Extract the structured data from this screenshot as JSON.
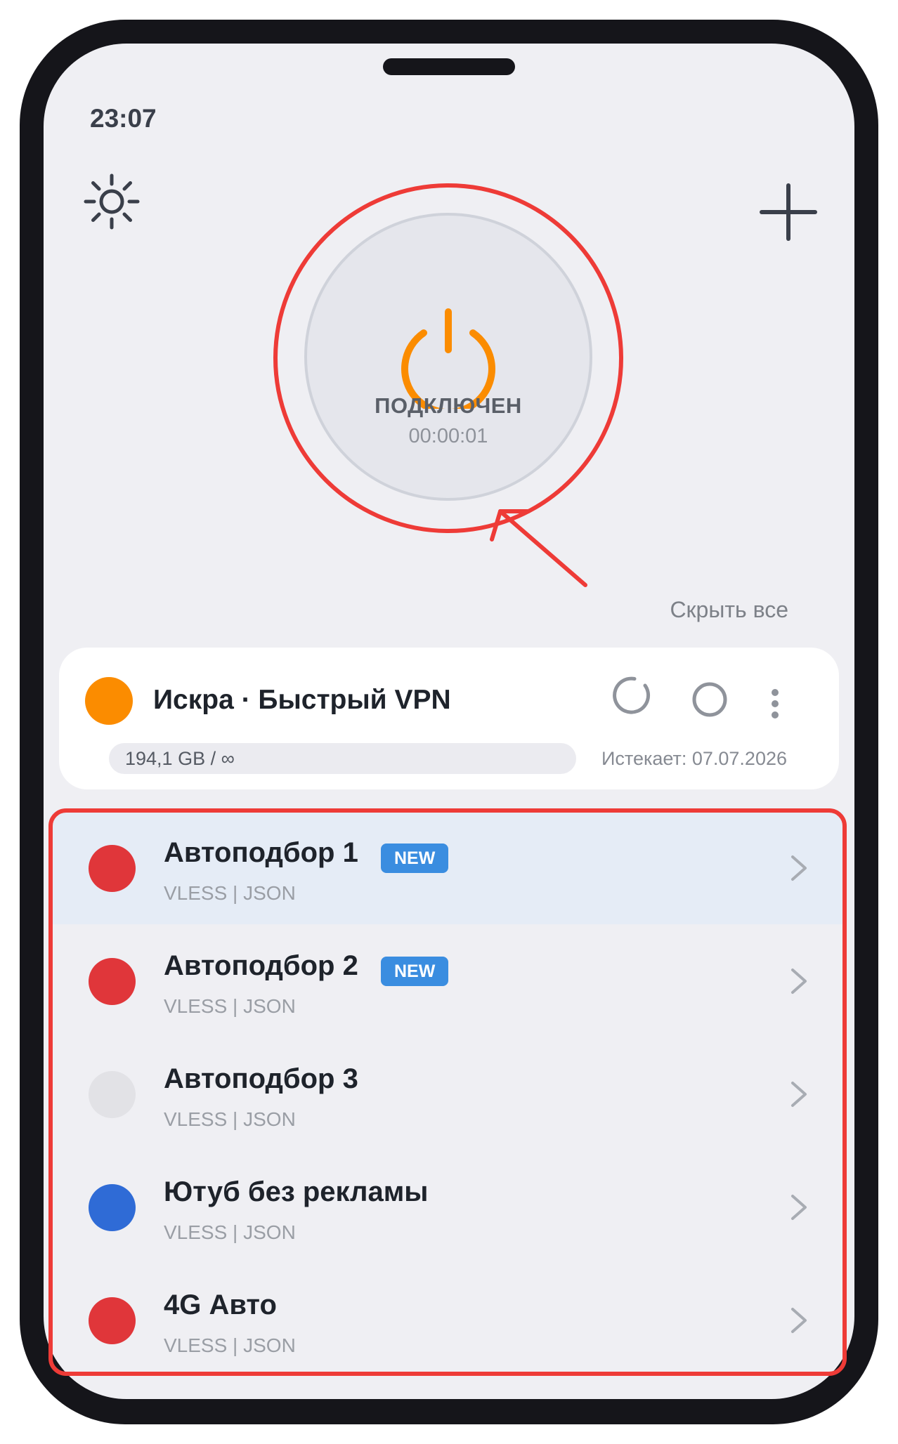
{
  "status_bar": {
    "time": "23:07"
  },
  "colors": {
    "accent_power": "#fb8c00",
    "annotation_red": "#ee3b37",
    "badge_blue": "#3a8de0"
  },
  "header": {
    "settings_icon": "sun-gear-icon",
    "add_icon": "plus-icon"
  },
  "connection": {
    "status": "ПОДКЛЮЧЕН",
    "timer": "00:00:01",
    "icon": "power-icon"
  },
  "hide_all_label": "Скрыть все",
  "subscription": {
    "name": "Искра · Быстрый VPN",
    "dot_color": "#fb8c00",
    "usage": "194,1 GB / ∞",
    "expires": "Истекает: 07.07.2026"
  },
  "servers": [
    {
      "name": "Автоподбор 1",
      "protocol": "VLESS | JSON",
      "badge": "NEW",
      "dot_color": "#e0363a",
      "highlighted": true
    },
    {
      "name": "Автоподбор 2",
      "protocol": "VLESS | JSON",
      "badge": "NEW",
      "dot_color": "#e0363a",
      "highlighted": false
    },
    {
      "name": "Автоподбор 3",
      "protocol": "VLESS | JSON",
      "badge": "",
      "dot_color": "#e2e2e6",
      "highlighted": false
    },
    {
      "name": "Ютуб без рекламы",
      "protocol": "VLESS | JSON",
      "badge": "",
      "dot_color": "#2f6bd6",
      "highlighted": false
    },
    {
      "name": "4G Авто",
      "protocol": "VLESS | JSON",
      "badge": "",
      "dot_color": "#e0363a",
      "highlighted": false
    }
  ]
}
